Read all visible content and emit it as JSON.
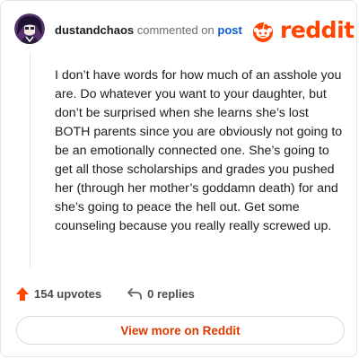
{
  "header": {
    "username": "dustandchaos",
    "action_text": "commented on",
    "link_text": "post"
  },
  "logo": {
    "word": "reddit",
    "color": "#ff4500"
  },
  "comment": {
    "body": "I don’t have words for how much of an asshole you are. Do whatever you want to your daughter, but don’t be surprised when she learns she’s lost BOTH parents since you are obviously not going to be an emotionally connected one. She’s going to get all those scholarships and grades you pushed her (through her mother’s goddamn death) for and she’s going to peace the hell out. Get some counseling because you really really screwed up."
  },
  "actions": {
    "upvotes_label": "154 upvotes",
    "upvote_icon": "upvote-arrow-icon",
    "replies_label": "0 replies",
    "reply_icon": "reply-arrow-icon"
  },
  "footer": {
    "view_more_label": "View more on Reddit"
  },
  "colors": {
    "accent": "#ff4500",
    "link": "#0f5bd6",
    "button_text": "#d93a00",
    "avatar_bg": "#55326e"
  }
}
